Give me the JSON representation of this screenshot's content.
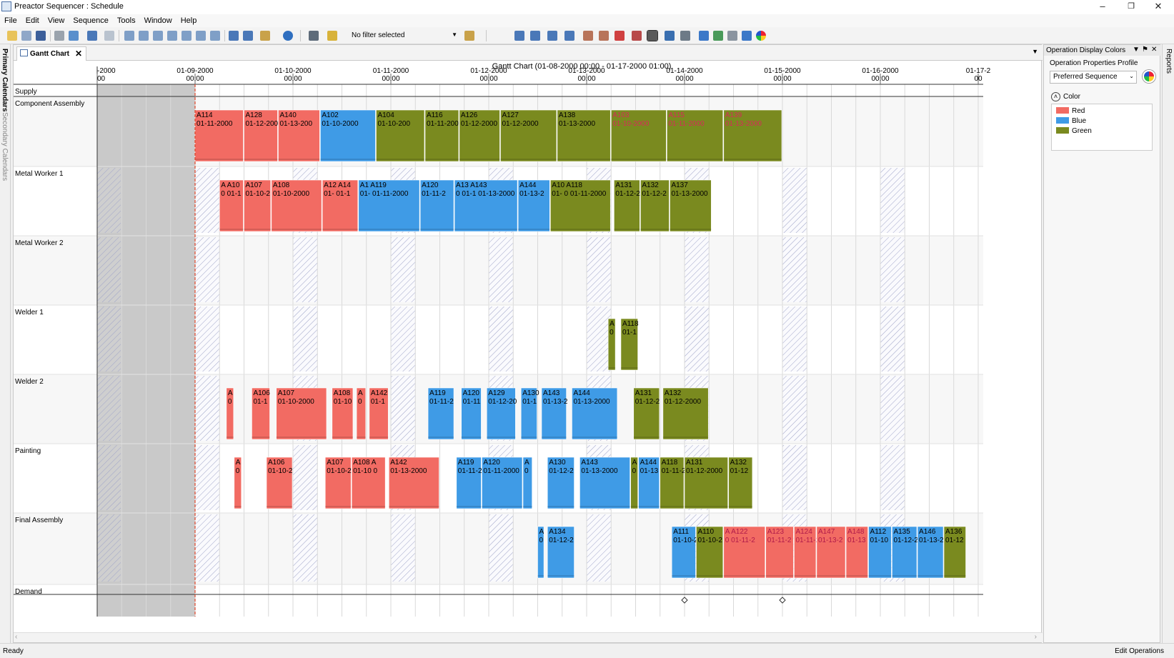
{
  "window": {
    "title": "Preactor Sequencer : Schedule"
  },
  "menu": [
    "File",
    "Edit",
    "View",
    "Sequence",
    "Tools",
    "Window",
    "Help"
  ],
  "toolbar": {
    "filter_text": "No filter selected"
  },
  "side_tabs": {
    "left": [
      "Primary Calendars",
      "Secondary Calendars"
    ],
    "right": [
      "Reports"
    ]
  },
  "document_tab": {
    "label": "Gantt Chart"
  },
  "gantt": {
    "title": "Gantt Chart   (01-08-2000 00:00 - 01-17-2000 01:00)",
    "timeline": [
      {
        "date": "-2000",
        "time": "00"
      },
      {
        "date": "01-09-2000",
        "time": "00:00"
      },
      {
        "date": "01-10-2000",
        "time": "00:00"
      },
      {
        "date": "01-11-2000",
        "time": "00:00"
      },
      {
        "date": "01-12-2000",
        "time": "00:00"
      },
      {
        "date": "01-13-2000",
        "time": "00:00"
      },
      {
        "date": "01-14-2000",
        "time": "00:00"
      },
      {
        "date": "01-15-2000",
        "time": "00:00"
      },
      {
        "date": "01-16-2000",
        "time": "00:00"
      },
      {
        "date": "01-17-2",
        "time": "00"
      }
    ],
    "resources": [
      "Supply",
      "Component Assembly",
      "Metal Worker 1",
      "Metal Worker 2",
      "Welder 1",
      "Welder 2",
      "Painting",
      "Final Assembly",
      "Demand"
    ],
    "operations": [
      {
        "res": 1,
        "id": "A114",
        "date": "01-11-2000",
        "color": "Red",
        "start": 1.0,
        "end": 1.5
      },
      {
        "res": 1,
        "id": "A128",
        "date": "01-12-200",
        "color": "Red",
        "start": 1.5,
        "end": 1.85
      },
      {
        "res": 1,
        "id": "A140",
        "date": "01-13-200",
        "color": "Red",
        "start": 1.85,
        "end": 2.28
      },
      {
        "res": 1,
        "id": "A102",
        "date": "01-10-2000",
        "color": "Blue",
        "start": 2.28,
        "end": 2.85
      },
      {
        "res": 1,
        "id": "A104",
        "date": "01-10-200",
        "color": "Green",
        "start": 2.85,
        "end": 3.35
      },
      {
        "res": 1,
        "id": "A116",
        "date": "01-11-200",
        "color": "Green",
        "start": 3.35,
        "end": 3.7
      },
      {
        "res": 1,
        "id": "A126",
        "date": "01-12-2000",
        "color": "Green",
        "start": 3.7,
        "end": 4.12
      },
      {
        "res": 1,
        "id": "A127",
        "date": "01-12-2000",
        "color": "Green",
        "start": 4.12,
        "end": 4.7
      },
      {
        "res": 1,
        "id": "A138",
        "date": "01-13-2000",
        "color": "Green",
        "start": 4.7,
        "end": 5.25
      },
      {
        "res": 1,
        "id": "A103",
        "date": "01-10-2000",
        "color": "Green",
        "start": 5.25,
        "end": 5.82
      },
      {
        "res": 1,
        "id": "A115",
        "date": "01-11-2000",
        "color": "Green",
        "start": 5.82,
        "end": 6.4
      },
      {
        "res": 1,
        "id": "A139",
        "date": "01-13-2000",
        "color": "Green",
        "start": 6.4,
        "end": 7.0
      },
      {
        "res": 2,
        "id": "A A10",
        "date": "0 01-1",
        "color": "Red",
        "start": 1.25,
        "end": 1.5
      },
      {
        "res": 2,
        "id": "A107",
        "date": "01-10-2",
        "color": "Red",
        "start": 1.5,
        "end": 1.78
      },
      {
        "res": 2,
        "id": "A108",
        "date": "01-10-2000",
        "color": "Red",
        "start": 1.78,
        "end": 2.3
      },
      {
        "res": 2,
        "id": "A12 A14",
        "date": "01- 01-1",
        "color": "Red",
        "start": 2.3,
        "end": 2.67
      },
      {
        "res": 2,
        "id": "A1 A119",
        "date": "01- 01-11-2000",
        "color": "Blue",
        "start": 2.67,
        "end": 3.3
      },
      {
        "res": 2,
        "id": "A120",
        "date": "01-11-2",
        "color": "Blue",
        "start": 3.3,
        "end": 3.65
      },
      {
        "res": 2,
        "id": "A13 A143",
        "date": "0 01-1 01-13-2000",
        "color": "Blue",
        "start": 3.65,
        "end": 4.3
      },
      {
        "res": 2,
        "id": "A144",
        "date": "01-13-2",
        "color": "Blue",
        "start": 4.3,
        "end": 4.63
      },
      {
        "res": 2,
        "id": "A10 A118",
        "date": "01- 0 01-11-2000",
        "color": "Green",
        "start": 4.63,
        "end": 5.25
      },
      {
        "res": 2,
        "id": "A131",
        "date": "01-12-2",
        "color": "Green",
        "start": 5.28,
        "end": 5.55
      },
      {
        "res": 2,
        "id": "A132",
        "date": "01-12-2",
        "color": "Green",
        "start": 5.55,
        "end": 5.85
      },
      {
        "res": 2,
        "id": "A137",
        "date": "01-13-2000",
        "color": "Green",
        "start": 5.85,
        "end": 6.28
      },
      {
        "res": 4,
        "id": "A",
        "date": "0",
        "color": "Green",
        "start": 5.22,
        "end": 5.3
      },
      {
        "res": 4,
        "id": "A118",
        "date": "01-1",
        "color": "Green",
        "start": 5.35,
        "end": 5.53
      },
      {
        "res": 5,
        "id": "A",
        "date": "0",
        "color": "Red",
        "start": 1.32,
        "end": 1.4
      },
      {
        "res": 5,
        "id": "A106",
        "date": "01-1",
        "color": "Red",
        "start": 1.58,
        "end": 1.77
      },
      {
        "res": 5,
        "id": "A107",
        "date": "01-10-2000",
        "color": "Red",
        "start": 1.83,
        "end": 2.35
      },
      {
        "res": 5,
        "id": "A108",
        "date": "01-10",
        "color": "Red",
        "start": 2.4,
        "end": 2.62
      },
      {
        "res": 5,
        "id": "A",
        "date": "0",
        "color": "Red",
        "start": 2.65,
        "end": 2.75
      },
      {
        "res": 5,
        "id": "A142",
        "date": "01-1",
        "color": "Red",
        "start": 2.78,
        "end": 2.98
      },
      {
        "res": 5,
        "id": "A119",
        "date": "01-11-2",
        "color": "Blue",
        "start": 3.38,
        "end": 3.65
      },
      {
        "res": 5,
        "id": "A120",
        "date": "01-11",
        "color": "Blue",
        "start": 3.72,
        "end": 3.93
      },
      {
        "res": 5,
        "id": "A129",
        "date": "01-12-20",
        "color": "Blue",
        "start": 3.98,
        "end": 4.28
      },
      {
        "res": 5,
        "id": "A130",
        "date": "01-1",
        "color": "Blue",
        "start": 4.33,
        "end": 4.5
      },
      {
        "res": 5,
        "id": "A143",
        "date": "01-13-2",
        "color": "Blue",
        "start": 4.54,
        "end": 4.8
      },
      {
        "res": 5,
        "id": "A144",
        "date": "01-13-2000",
        "color": "Blue",
        "start": 4.85,
        "end": 5.32
      },
      {
        "res": 5,
        "id": "A131",
        "date": "01-12-2",
        "color": "Green",
        "start": 5.48,
        "end": 5.75
      },
      {
        "res": 5,
        "id": "A132",
        "date": "01-12-2000",
        "color": "Green",
        "start": 5.78,
        "end": 6.25
      },
      {
        "res": 6,
        "id": "A",
        "date": "0",
        "color": "Red",
        "start": 1.4,
        "end": 1.48
      },
      {
        "res": 6,
        "id": "A106",
        "date": "01-10-2",
        "color": "Red",
        "start": 1.73,
        "end": 2.0
      },
      {
        "res": 6,
        "id": "A107",
        "date": "01-10-2",
        "color": "Red",
        "start": 2.33,
        "end": 2.6
      },
      {
        "res": 6,
        "id": "A108 A",
        "date": "01-10 0",
        "color": "Red",
        "start": 2.6,
        "end": 2.95
      },
      {
        "res": 6,
        "id": "A142",
        "date": "01-13-2000",
        "color": "Red",
        "start": 2.98,
        "end": 3.5
      },
      {
        "res": 6,
        "id": "A119",
        "date": "01-11-2",
        "color": "Blue",
        "start": 3.67,
        "end": 3.93
      },
      {
        "res": 6,
        "id": "A120",
        "date": "01-11-2000",
        "color": "Blue",
        "start": 3.93,
        "end": 4.35
      },
      {
        "res": 6,
        "id": "A",
        "date": "0",
        "color": "Blue",
        "start": 4.35,
        "end": 4.45
      },
      {
        "res": 6,
        "id": "A130",
        "date": "01-12-2",
        "color": "Blue",
        "start": 4.6,
        "end": 4.88
      },
      {
        "res": 6,
        "id": "A143",
        "date": "01-13-2000",
        "color": "Blue",
        "start": 4.93,
        "end": 5.45
      },
      {
        "res": 6,
        "id": "A",
        "date": "0",
        "color": "Green",
        "start": 5.45,
        "end": 5.53
      },
      {
        "res": 6,
        "id": "A144",
        "date": "01-13",
        "color": "Blue",
        "start": 5.53,
        "end": 5.75
      },
      {
        "res": 6,
        "id": "A118",
        "date": "01-11-2",
        "color": "Green",
        "start": 5.75,
        "end": 6.0
      },
      {
        "res": 6,
        "id": "A131",
        "date": "01-12-2000",
        "color": "Green",
        "start": 6.0,
        "end": 6.45
      },
      {
        "res": 6,
        "id": "A132",
        "date": "01-12",
        "color": "Green",
        "start": 6.45,
        "end": 6.7
      },
      {
        "res": 7,
        "id": "A",
        "date": "0",
        "color": "Blue",
        "start": 4.5,
        "end": 4.57
      },
      {
        "res": 7,
        "id": "A134",
        "date": "01-12-2",
        "color": "Blue",
        "start": 4.6,
        "end": 4.88
      },
      {
        "res": 7,
        "id": "A111",
        "date": "01-10-2",
        "color": "Blue",
        "start": 5.87,
        "end": 6.12
      },
      {
        "res": 7,
        "id": "A110",
        "date": "01-10-2",
        "color": "Green",
        "start": 6.12,
        "end": 6.4
      },
      {
        "res": 7,
        "id": "A A122",
        "date": "0 01-11-2",
        "color": "Red",
        "start": 6.4,
        "end": 6.83
      },
      {
        "res": 7,
        "id": "A123",
        "date": "01-11-2",
        "color": "Red",
        "start": 6.83,
        "end": 7.12
      },
      {
        "res": 7,
        "id": "A124",
        "date": "01-11-2",
        "color": "Red",
        "start": 7.12,
        "end": 7.35
      },
      {
        "res": 7,
        "id": "A147",
        "date": "01-13-2",
        "color": "Red",
        "start": 7.35,
        "end": 7.65
      },
      {
        "res": 7,
        "id": "A148",
        "date": "01-13",
        "color": "Red",
        "start": 7.65,
        "end": 7.88
      },
      {
        "res": 7,
        "id": "A112",
        "date": "01-10",
        "color": "Blue",
        "start": 7.88,
        "end": 8.12
      },
      {
        "res": 7,
        "id": "A135",
        "date": "01-12-2",
        "color": "Blue",
        "start": 8.12,
        "end": 8.38
      },
      {
        "res": 7,
        "id": "A146",
        "date": "01-13-2",
        "color": "Blue",
        "start": 8.38,
        "end": 8.65
      },
      {
        "res": 7,
        "id": "A136",
        "date": "01-12",
        "color": "Green",
        "start": 8.65,
        "end": 8.88
      }
    ],
    "demand_markers": [
      6.0,
      7.0
    ]
  },
  "panel": {
    "title": "Operation Display Colors",
    "profile_label": "Operation Properties Profile",
    "profile_value": "Preferred Sequence",
    "group_label": "Color",
    "legend": [
      {
        "label": "Red",
        "color": "#f26b63"
      },
      {
        "label": "Blue",
        "color": "#3f9be6"
      },
      {
        "label": "Green",
        "color": "#7a8a1f"
      }
    ]
  },
  "colors": {
    "Red": "#f26b63",
    "Blue": "#3f9be6",
    "Green": "#7a8a1f",
    "now_line": "#e0482c"
  },
  "status": {
    "left": "Ready",
    "right": "Edit Operations"
  }
}
